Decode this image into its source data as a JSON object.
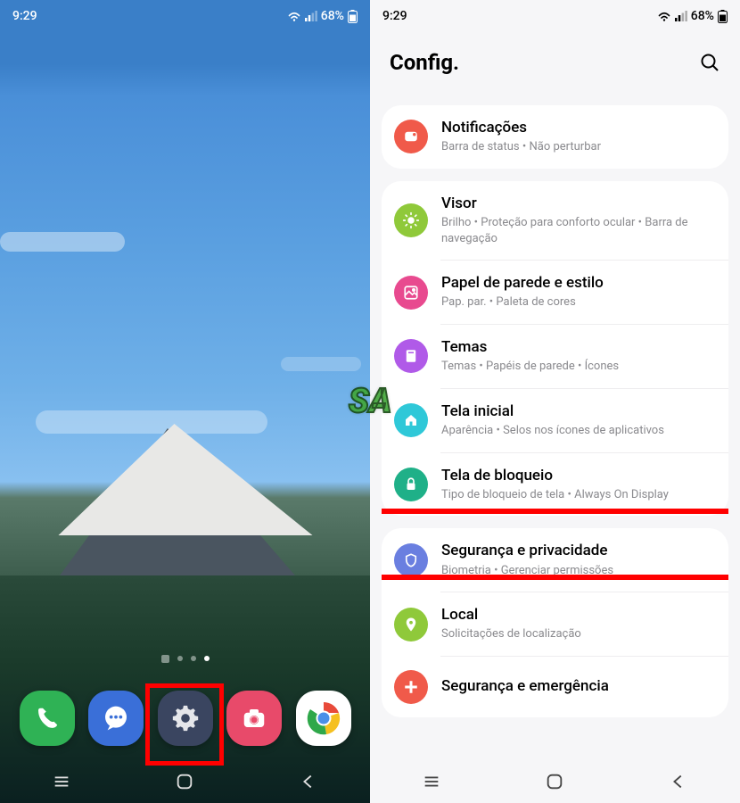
{
  "status": {
    "time": "9:29",
    "battery": "68%"
  },
  "watermark": "SA",
  "home": {
    "dock": [
      {
        "name": "phone",
        "color": "#2fb255"
      },
      {
        "name": "messages",
        "color": "#3a6fd8"
      },
      {
        "name": "settings",
        "color": "#3a4560"
      },
      {
        "name": "camera",
        "color": "#e84a6a"
      },
      {
        "name": "chrome",
        "color": "#ffffff"
      }
    ]
  },
  "settings": {
    "title": "Config.",
    "groups": [
      [
        {
          "icon": "notifications",
          "color": "#f05a4a",
          "title": "Notificações",
          "sub": "Barra de status  •  Não perturbar"
        }
      ],
      [
        {
          "icon": "display",
          "color": "#8fc93a",
          "title": "Visor",
          "sub": "Brilho  •  Proteção para conforto ocular  •  Barra de navegação"
        },
        {
          "icon": "wallpaper",
          "color": "#e84a8f",
          "title": "Papel de parede e estilo",
          "sub": "Pap. par.  •  Paleta de cores"
        },
        {
          "icon": "themes",
          "color": "#b05ae8",
          "title": "Temas",
          "sub": "Temas  •  Papéis de parede  •  Ícones"
        },
        {
          "icon": "home",
          "color": "#2fc8d8",
          "title": "Tela inicial",
          "sub": "Aparência  •  Selos nos ícones de aplicativos"
        },
        {
          "icon": "lock",
          "color": "#1fb088",
          "title": "Tela de bloqueio",
          "sub": "Tipo de bloqueio de tela  •  Always On Display",
          "highlighted": true
        }
      ],
      [
        {
          "icon": "security",
          "color": "#6a7fe0",
          "title": "Segurança e privacidade",
          "sub": "Biometria  •  Gerenciar permissões"
        },
        {
          "icon": "location",
          "color": "#8fc93a",
          "title": "Local",
          "sub": "Solicitações de localização"
        },
        {
          "icon": "emergency",
          "color": "#f05a4a",
          "title": "Segurança e emergência",
          "sub": ""
        }
      ]
    ]
  }
}
